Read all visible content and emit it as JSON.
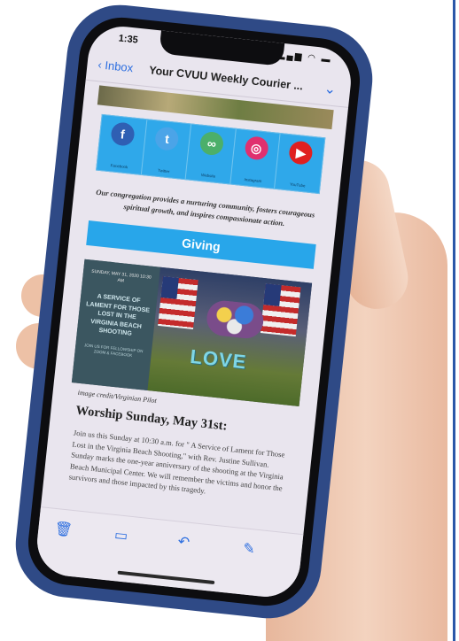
{
  "status": {
    "time": "1:35",
    "signal_icons": "▂▄▆ ◠ ▬"
  },
  "nav": {
    "back_label": "Inbox",
    "subject": "Your CVUU Weekly Courier ...",
    "chevron": "⌄"
  },
  "social": [
    {
      "icon": "facebook-icon",
      "glyph": "f",
      "color": "#2f5fb3",
      "label": "Facebook"
    },
    {
      "icon": "twitter-icon",
      "glyph": "t",
      "color": "#4ba4e8",
      "label": "Twitter"
    },
    {
      "icon": "link-icon",
      "glyph": "∞",
      "color": "#4caf6a",
      "label": "Website"
    },
    {
      "icon": "instagram-icon",
      "glyph": "◎",
      "color": "#e0306f",
      "label": "Instagram"
    },
    {
      "icon": "youtube-icon",
      "glyph": "▶",
      "color": "#e02020",
      "label": "YouTube"
    }
  ],
  "mission": "Our congregation provides a nurturing community, fosters courageous spiritual growth, and inspires compassionate action.",
  "giving_label": "Giving",
  "hero": {
    "date_line": "SUNDAY, MAY 31, 2020 10:30 AM",
    "title": "A SERVICE OF LAMENT FOR THOSE LOST IN THE VIRGINIA BEACH SHOOTING",
    "join": "JOIN US FOR FELLOWSHIP ON ZOOM & FACEBOOK",
    "love_text": "LOVE"
  },
  "image_credit": "image credit/Virginian Pilot",
  "worship_title": "Worship Sunday, May 31st:",
  "worship_body": "Join us this Sunday at 10:30 a.m. for \" A Service of Lament for Those Lost in the Virginia Beach Shooting,\" with Rev. Justine Sullivan. Sunday marks the one-year anniversary of the shooting at the Virginia Beach Municipal Center. We will remember the victims and honor the survivors and those impacted by this tragedy.",
  "toolbar": {
    "trash": "🗑",
    "folder": "▭",
    "reply": "↶",
    "compose": "✎"
  }
}
